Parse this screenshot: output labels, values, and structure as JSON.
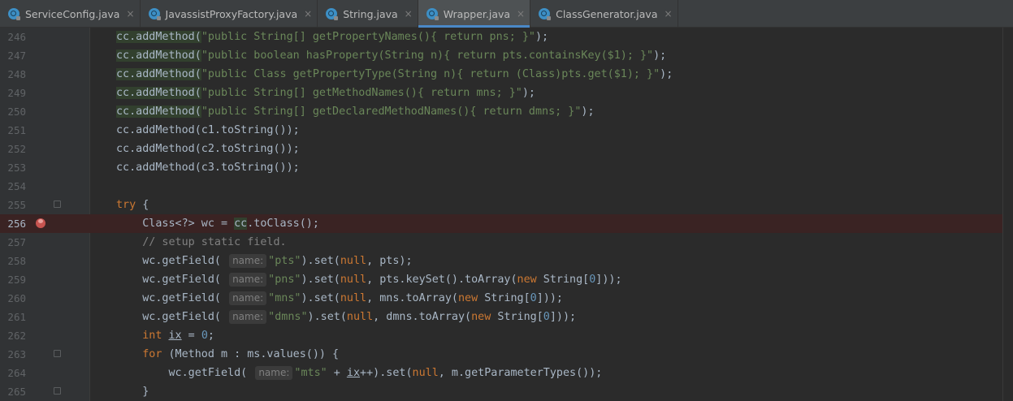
{
  "tabs": [
    {
      "label": "ServiceConfig.java",
      "active": false
    },
    {
      "label": "JavassistProxyFactory.java",
      "active": false
    },
    {
      "label": "String.java",
      "active": false
    },
    {
      "label": "Wrapper.java",
      "active": true
    },
    {
      "label": "ClassGenerator.java",
      "active": false
    }
  ],
  "tab_close_glyph": "×",
  "code": {
    "lines": [
      {
        "num": "246",
        "p": [
          "cc.addMethod(",
          "\"public String[] getPropertyNames(){ return pns; }\"",
          ");"
        ]
      },
      {
        "num": "247",
        "p": [
          "cc.addMethod(",
          "\"public boolean hasProperty(String n){ return pts.containsKey($1); }\"",
          ");"
        ]
      },
      {
        "num": "248",
        "p": [
          "cc.addMethod(",
          "\"public Class getPropertyType(String n){ return (Class)pts.get($1); }\"",
          ");"
        ]
      },
      {
        "num": "249",
        "p": [
          "cc.addMethod(",
          "\"public String[] getMethodNames(){ return mns; }\"",
          ");"
        ]
      },
      {
        "num": "250",
        "p": [
          "cc.addMethod(",
          "\"public String[] getDeclaredMethodNames(){ return dmns; }\"",
          ");"
        ]
      },
      {
        "num": "251",
        "p": [
          "cc.addMethod(c1.toString());"
        ]
      },
      {
        "num": "252",
        "p": [
          "cc.addMethod(c2.toString());"
        ]
      },
      {
        "num": "253",
        "p": [
          "cc.addMethod(c3.toString());"
        ]
      },
      {
        "num": "254",
        "p": [
          ""
        ]
      },
      {
        "num": "255",
        "p": [
          "try",
          " {"
        ]
      },
      {
        "num": "256",
        "p": [
          "    Class<?> wc = ",
          "cc",
          ".toClass();"
        ]
      },
      {
        "num": "257",
        "p": [
          "    // setup static field."
        ]
      },
      {
        "num": "258",
        "p": [
          "    wc.getField( ",
          "name:",
          "\"pts\"",
          ").set(",
          "null",
          ", pts);"
        ]
      },
      {
        "num": "259",
        "p": [
          "    wc.getField( ",
          "name:",
          "\"pns\"",
          ").set(",
          "null",
          ", pts.keySet().toArray(",
          "new",
          " String[",
          "0",
          "]));"
        ]
      },
      {
        "num": "260",
        "p": [
          "    wc.getField( ",
          "name:",
          "\"mns\"",
          ").set(",
          "null",
          ", mns.toArray(",
          "new",
          " String[",
          "0",
          "]));"
        ]
      },
      {
        "num": "261",
        "p": [
          "    wc.getField( ",
          "name:",
          "\"dmns\"",
          ").set(",
          "null",
          ", dmns.toArray(",
          "new",
          " String[",
          "0",
          "]));"
        ]
      },
      {
        "num": "262",
        "p": [
          "    ",
          "int",
          " ",
          "ix",
          " = ",
          "0",
          ";"
        ]
      },
      {
        "num": "263",
        "p": [
          "    ",
          "for",
          " (Method m : ms.values()) {"
        ]
      },
      {
        "num": "264",
        "p": [
          "        wc.getField( ",
          "name:",
          "\"mts\"",
          " + ",
          "ix",
          "++).set(",
          "null",
          ", m.getParameterTypes());"
        ]
      },
      {
        "num": "265",
        "p": [
          "    }"
        ]
      }
    ]
  },
  "colors": {
    "editor_bg": "#2b2b2b",
    "string": "#6a8759",
    "keyword": "#cc7832",
    "number": "#6897bb",
    "comment": "#808080",
    "breakpoint_line": "#3a2323",
    "active_tab_underline": "#4a88c7"
  }
}
